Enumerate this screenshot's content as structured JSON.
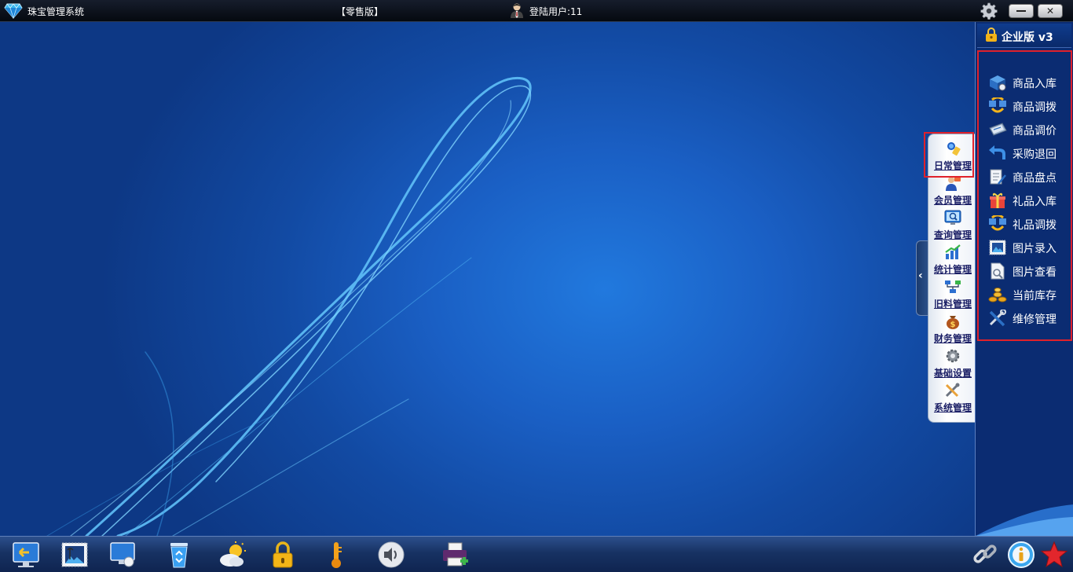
{
  "titlebar": {
    "app_title": "珠宝管理系统",
    "edition": "【零售版】",
    "user_label": "登陆用户:11"
  },
  "categories": [
    {
      "label": "日常管理",
      "icon": "daily-management-icon",
      "selected": true
    },
    {
      "label": "会员管理",
      "icon": "member-icon"
    },
    {
      "label": "查询管理",
      "icon": "query-icon"
    },
    {
      "label": "统计管理",
      "icon": "statistics-icon"
    },
    {
      "label": "旧料管理",
      "icon": "old-material-icon"
    },
    {
      "label": "财务管理",
      "icon": "finance-icon"
    },
    {
      "label": "基础设置",
      "icon": "settings-icon"
    },
    {
      "label": "系统管理",
      "icon": "system-icon"
    }
  ],
  "right_panel": {
    "edition": "企业版 v3",
    "items": [
      {
        "label": "商品入库",
        "icon": "goods-inbound-icon"
      },
      {
        "label": "商品调拨",
        "icon": "goods-transfer-icon"
      },
      {
        "label": "商品调价",
        "icon": "price-adjust-icon"
      },
      {
        "label": "采购退回",
        "icon": "purchase-return-icon"
      },
      {
        "label": "商品盘点",
        "icon": "inventory-check-icon"
      },
      {
        "label": "礼品入库",
        "icon": "gift-inbound-icon"
      },
      {
        "label": "礼品调拨",
        "icon": "gift-transfer-icon"
      },
      {
        "label": "图片录入",
        "icon": "picture-entry-icon"
      },
      {
        "label": "图片查看",
        "icon": "picture-view-icon"
      },
      {
        "label": "当前库存",
        "icon": "current-stock-icon"
      },
      {
        "label": "维修管理",
        "icon": "repair-icon"
      }
    ]
  },
  "taskbar": {
    "left_icons": [
      "switch-screen-icon",
      "stamp-picture-icon",
      "display-icon",
      "recycle-bin-icon",
      "weather-icon",
      "lock-icon",
      "thermometer-icon",
      "speaker-icon",
      "printer-icon"
    ],
    "right_icons": [
      "link-icon",
      "info-icon",
      "star-icon"
    ]
  },
  "colors": {
    "highlight_border": "#e0212b",
    "desktop_blue": "#1a5fc4",
    "category_label": "#1b1f66"
  }
}
